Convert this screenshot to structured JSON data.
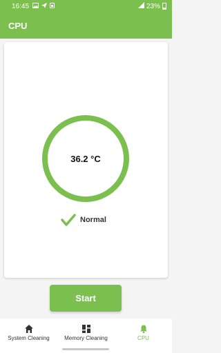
{
  "status_bar": {
    "time": "16:45",
    "battery": "23%"
  },
  "app_bar": {
    "title": "CPU"
  },
  "monitor": {
    "temperature": "36.2 °C",
    "status": "Normal"
  },
  "actions": {
    "start_label": "Start"
  },
  "bottom_nav": {
    "items": [
      {
        "label": "System Cleaning",
        "icon": "home-icon",
        "active": false
      },
      {
        "label": "Memory Cleaning",
        "icon": "grid-icon",
        "active": false
      },
      {
        "label": "CPU",
        "icon": "bell-icon",
        "active": true
      }
    ]
  },
  "colors": {
    "accent": "#7bbf4f",
    "background": "#f4f4f4",
    "card": "#ffffff"
  }
}
